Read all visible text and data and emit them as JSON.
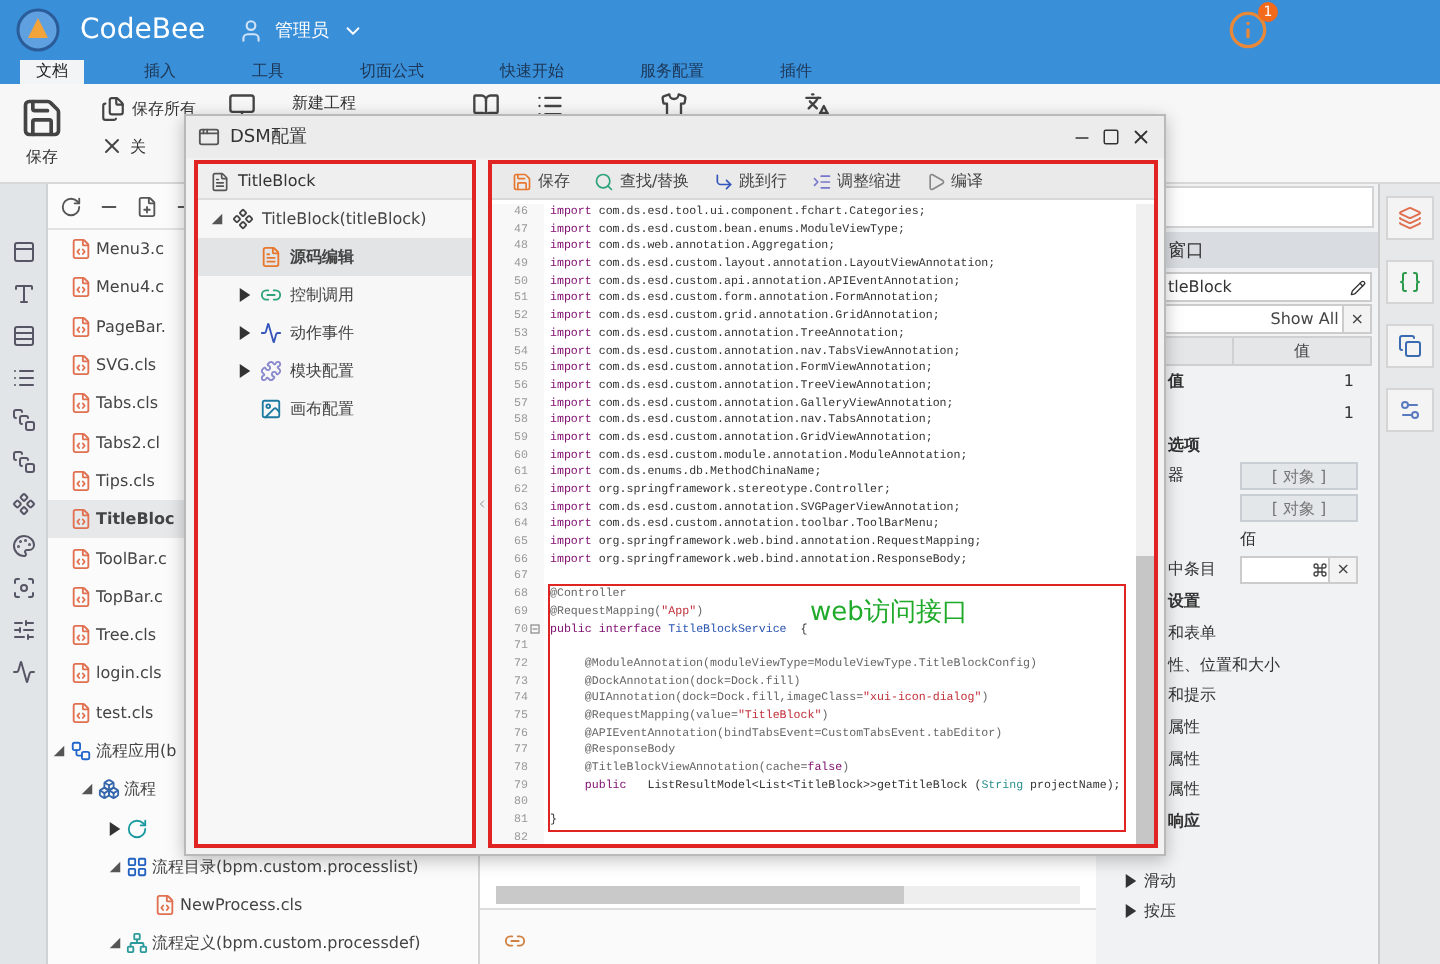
{
  "app": {
    "name": "CodeBee",
    "user": "管理员",
    "notification_count": "1"
  },
  "menu_tabs": [
    {
      "label": "文档",
      "selected": true
    },
    {
      "label": "插入",
      "selected": false
    },
    {
      "label": "工具",
      "selected": false
    },
    {
      "label": "切面公式",
      "selected": false
    },
    {
      "label": "快速开始",
      "selected": false
    },
    {
      "label": "服务配置",
      "selected": false
    },
    {
      "label": "插件",
      "selected": false
    }
  ],
  "ribbon": {
    "save": "保存",
    "save_all": "保存所有",
    "close": "关",
    "new_project": "新建工程"
  },
  "file_tree": {
    "items": [
      {
        "label": "Menu3.c",
        "kind": "cls",
        "selected": false
      },
      {
        "label": "Menu4.c",
        "kind": "cls",
        "selected": false
      },
      {
        "label": "PageBar.",
        "kind": "cls",
        "selected": false
      },
      {
        "label": "SVG.cls",
        "kind": "cls",
        "selected": false
      },
      {
        "label": "Tabs.cls",
        "kind": "cls",
        "selected": false
      },
      {
        "label": "Tabs2.cl",
        "kind": "cls",
        "selected": false
      },
      {
        "label": "Tips.cls",
        "kind": "cls",
        "selected": false
      },
      {
        "label": "TitleBloc",
        "kind": "cls",
        "selected": true
      },
      {
        "label": "ToolBar.c",
        "kind": "cls",
        "selected": false
      },
      {
        "label": "TopBar.c",
        "kind": "cls",
        "selected": false
      },
      {
        "label": "Tree.cls",
        "kind": "cls",
        "selected": false
      },
      {
        "label": "login.cls",
        "kind": "cls",
        "selected": false
      },
      {
        "label": "test.cls",
        "kind": "cls",
        "selected": false
      },
      {
        "label": "流程应用(b",
        "kind": "app",
        "expanded": true,
        "selected": false,
        "children": [
          {
            "label": "流程",
            "kind": "group",
            "expanded": true,
            "selected": false,
            "children": [
              {
                "kind": "process",
                "expanded": false,
                "selected": false
              },
              {
                "label": "流程目录(bpm.custom.processlist)",
                "kind": "folder",
                "expanded": true,
                "selected": false,
                "children": [
                  {
                    "label": "NewProcess.cls",
                    "kind": "cls",
                    "selected": false
                  }
                ]
              },
              {
                "label": "流程定义(bpm.custom.processdef)",
                "kind": "definition",
                "expanded": true,
                "selected": false
              }
            ]
          }
        ]
      }
    ]
  },
  "dialog": {
    "title": "DSM配置",
    "nav": {
      "header": "TitleBlock",
      "items": [
        {
          "label": "TitleBlock(titleBlock)",
          "kind": "component",
          "expanded": true,
          "selected": false,
          "children": [
            {
              "label": "源码编辑",
              "kind": "source",
              "selected": true
            },
            {
              "label": "控制调用",
              "kind": "control",
              "expanded": false,
              "selected": false
            },
            {
              "label": "动作事件",
              "kind": "event",
              "expanded": false,
              "selected": false
            },
            {
              "label": "模块配置",
              "kind": "module",
              "expanded": false,
              "selected": false
            },
            {
              "label": "画布配置",
              "kind": "canvas",
              "selected": false
            }
          ]
        }
      ]
    },
    "toolbar": [
      {
        "label": "保存",
        "kind": "save"
      },
      {
        "label": "查找/替换",
        "kind": "find"
      },
      {
        "label": "跳到行",
        "kind": "goto"
      },
      {
        "label": "调整缩进",
        "kind": "indent"
      },
      {
        "label": "编译",
        "kind": "compile"
      }
    ],
    "code": {
      "before": [
        {
          "number": "46",
          "tokens": [
            {
              "kind": "keyword",
              "text": "import"
            },
            {
              "kind": "plain",
              "text": " com.ds.esd.tool.ui.component.fchart.Categories;"
            }
          ]
        },
        {
          "number": "47",
          "tokens": [
            {
              "kind": "keyword",
              "text": "import"
            },
            {
              "kind": "plain",
              "text": " com.ds.esd.custom.bean.enums.ModuleViewType;"
            }
          ]
        },
        {
          "number": "48",
          "tokens": [
            {
              "kind": "keyword",
              "text": "import"
            },
            {
              "kind": "plain",
              "text": " com.ds.web.annotation.Aggregation;"
            }
          ]
        },
        {
          "number": "49",
          "tokens": [
            {
              "kind": "keyword",
              "text": "import"
            },
            {
              "kind": "plain",
              "text": " com.ds.esd.custom.layout.annotation.LayoutViewAnnotation;"
            }
          ]
        },
        {
          "number": "50",
          "tokens": [
            {
              "kind": "keyword",
              "text": "import"
            },
            {
              "kind": "plain",
              "text": " com.ds.esd.custom.api.annotation.APIEventAnnotation;"
            }
          ]
        },
        {
          "number": "51",
          "tokens": [
            {
              "kind": "keyword",
              "text": "import"
            },
            {
              "kind": "plain",
              "text": " com.ds.esd.custom.form.annotation.FormAnnotation;"
            }
          ]
        },
        {
          "number": "52",
          "tokens": [
            {
              "kind": "keyword",
              "text": "import"
            },
            {
              "kind": "plain",
              "text": " com.ds.esd.custom.grid.annotation.GridAnnotation;"
            }
          ]
        },
        {
          "number": "53",
          "tokens": [
            {
              "kind": "keyword",
              "text": "import"
            },
            {
              "kind": "plain",
              "text": " com.ds.esd.custom.annotation.TreeAnnotation;"
            }
          ]
        },
        {
          "number": "54",
          "tokens": [
            {
              "kind": "keyword",
              "text": "import"
            },
            {
              "kind": "plain",
              "text": " com.ds.esd.custom.annotation.nav.TabsViewAnnotation;"
            }
          ]
        },
        {
          "number": "55",
          "tokens": [
            {
              "kind": "keyword",
              "text": "import"
            },
            {
              "kind": "plain",
              "text": " com.ds.esd.custom.annotation.FormViewAnnotation;"
            }
          ]
        },
        {
          "number": "56",
          "tokens": [
            {
              "kind": "keyword",
              "text": "import"
            },
            {
              "kind": "plain",
              "text": " com.ds.esd.custom.annotation.TreeViewAnnotation;"
            }
          ]
        },
        {
          "number": "57",
          "tokens": [
            {
              "kind": "keyword",
              "text": "import"
            },
            {
              "kind": "plain",
              "text": " com.ds.esd.custom.annotation.GalleryViewAnnotation;"
            }
          ]
        },
        {
          "number": "58",
          "tokens": [
            {
              "kind": "keyword",
              "text": "import"
            },
            {
              "kind": "plain",
              "text": " com.ds.esd.custom.annotation.nav.TabsAnnotation;"
            }
          ]
        },
        {
          "number": "59",
          "tokens": [
            {
              "kind": "keyword",
              "text": "import"
            },
            {
              "kind": "plain",
              "text": " com.ds.esd.custom.annotation.GridViewAnnotation;"
            }
          ]
        },
        {
          "number": "60",
          "tokens": [
            {
              "kind": "keyword",
              "text": "import"
            },
            {
              "kind": "plain",
              "text": " com.ds.esd.custom.module.annotation.ModuleAnnotation;"
            }
          ]
        },
        {
          "number": "61",
          "tokens": [
            {
              "kind": "keyword",
              "text": "import"
            },
            {
              "kind": "plain",
              "text": " com.ds.enums.db.MethodChinaName;"
            }
          ]
        },
        {
          "number": "62",
          "tokens": [
            {
              "kind": "keyword",
              "text": "import"
            },
            {
              "kind": "plain",
              "text": " org.springframework.stereotype.Controller;"
            }
          ]
        },
        {
          "number": "63",
          "tokens": [
            {
              "kind": "keyword",
              "text": "import"
            },
            {
              "kind": "plain",
              "text": " com.ds.esd.custom.annotation.SVGPagerViewAnnotation;"
            }
          ]
        },
        {
          "number": "64",
          "tokens": [
            {
              "kind": "keyword",
              "text": "import"
            },
            {
              "kind": "plain",
              "text": " com.ds.esd.custom.annotation.toolbar.ToolBarMenu;"
            }
          ]
        },
        {
          "number": "65",
          "tokens": [
            {
              "kind": "keyword",
              "text": "import"
            },
            {
              "kind": "plain",
              "text": " org.springframework.web.bind.annotation.RequestMapping;"
            }
          ]
        },
        {
          "number": "66",
          "tokens": [
            {
              "kind": "keyword",
              "text": "import"
            },
            {
              "kind": "plain",
              "text": " org.springframework.web.bind.annotation.ResponseBody;"
            }
          ]
        },
        {
          "number": "67"
        }
      ],
      "callout": {
        "label": "web访问接口",
        "lines": [
          {
            "number": "68",
            "tokens": [
              {
                "kind": "annotation",
                "text": "@Controller"
              }
            ]
          },
          {
            "number": "69",
            "tokens": [
              {
                "kind": "annotation",
                "text": "@RequestMapping("
              },
              {
                "kind": "string",
                "text": "\"App\""
              },
              {
                "kind": "annotation",
                "text": ")"
              }
            ]
          },
          {
            "number": "70",
            "kind": "fold",
            "tokens": [
              {
                "kind": "keyword",
                "text": "public interface"
              },
              {
                "kind": "type",
                "text": " TitleBlockService"
              },
              {
                "kind": "plain",
                "text": "  {"
              }
            ]
          },
          {
            "number": "71"
          },
          {
            "number": "72",
            "tokens": [
              {
                "kind": "annotation",
                "text": "     @ModuleAnnotation(moduleViewType=ModuleViewType.TitleBlockConfig)"
              }
            ]
          },
          {
            "number": "73",
            "tokens": [
              {
                "kind": "annotation",
                "text": "     @DockAnnotation(dock=Dock.fill)"
              }
            ]
          },
          {
            "number": "74",
            "tokens": [
              {
                "kind": "annotation",
                "text": "     @UIAnnotation(dock=Dock.fill,imageClass="
              },
              {
                "kind": "string",
                "text": "\"xui-icon-dialog\""
              },
              {
                "kind": "annotation",
                "text": ")"
              }
            ]
          },
          {
            "number": "75",
            "tokens": [
              {
                "kind": "annotation",
                "text": "     @RequestMapping(value="
              },
              {
                "kind": "string",
                "text": "\"TitleBlock\""
              },
              {
                "kind": "annotation",
                "text": ")"
              }
            ]
          },
          {
            "number": "76",
            "tokens": [
              {
                "kind": "annotation",
                "text": "     @APIEventAnnotation(bindTabsEvent=CustomTabsEvent.tabEditor)"
              }
            ]
          },
          {
            "number": "77",
            "tokens": [
              {
                "kind": "annotation",
                "text": "     @ResponseBody"
              }
            ]
          },
          {
            "number": "78",
            "tokens": [
              {
                "kind": "annotation",
                "text": "     @TitleBlockViewAnnotation(cache="
              },
              {
                "kind": "keyword",
                "text": "false"
              },
              {
                "kind": "annotation",
                "text": ")"
              }
            ]
          },
          {
            "number": "79",
            "tokens": [
              {
                "kind": "keyword",
                "text": "     public"
              },
              {
                "kind": "plain",
                "text": "   ListResultModel<List<TitleBlock>>getTitleBlock ("
              },
              {
                "kind": "builtin",
                "text": "String"
              },
              {
                "kind": "plain",
                "text": " projectName);"
              }
            ]
          },
          {
            "number": "80"
          },
          {
            "number": "81",
            "tokens": [
              {
                "kind": "plain",
                "text": "}"
              }
            ]
          }
        ]
      },
      "after": [
        {
          "number": "82"
        }
      ]
    }
  },
  "properties": {
    "title": "窗口",
    "object": "tleBlock",
    "filter": "Show All",
    "clear": "×",
    "value_header": "值",
    "rows": [
      {
        "kind": "group",
        "label": "值",
        "value": "1"
      },
      {
        "kind": "value",
        "value": "1"
      },
      {
        "kind": "group",
        "label": "选项"
      },
      {
        "kind": "object",
        "label": "器",
        "value": "[ 对象 ]"
      },
      {
        "kind": "object",
        "value": "[ 对象 ]"
      },
      {
        "kind": "value",
        "value": "佰"
      },
      {
        "kind": "input",
        "label": "中条目",
        "clear": "×"
      },
      {
        "kind": "group",
        "label": "设置"
      },
      {
        "kind": "category",
        "label": "和表单"
      },
      {
        "kind": "category",
        "label": "性、位置和大小"
      },
      {
        "kind": "category",
        "label": "和提示"
      },
      {
        "kind": "category",
        "label": "属性"
      },
      {
        "kind": "category",
        "label": "属性"
      },
      {
        "kind": "category",
        "label": "属性"
      },
      {
        "kind": "group",
        "label": "响应"
      },
      {
        "kind": "event",
        "label": "滑动",
        "expanded": false
      },
      {
        "kind": "event",
        "label": "按压",
        "expanded": false
      }
    ]
  }
}
